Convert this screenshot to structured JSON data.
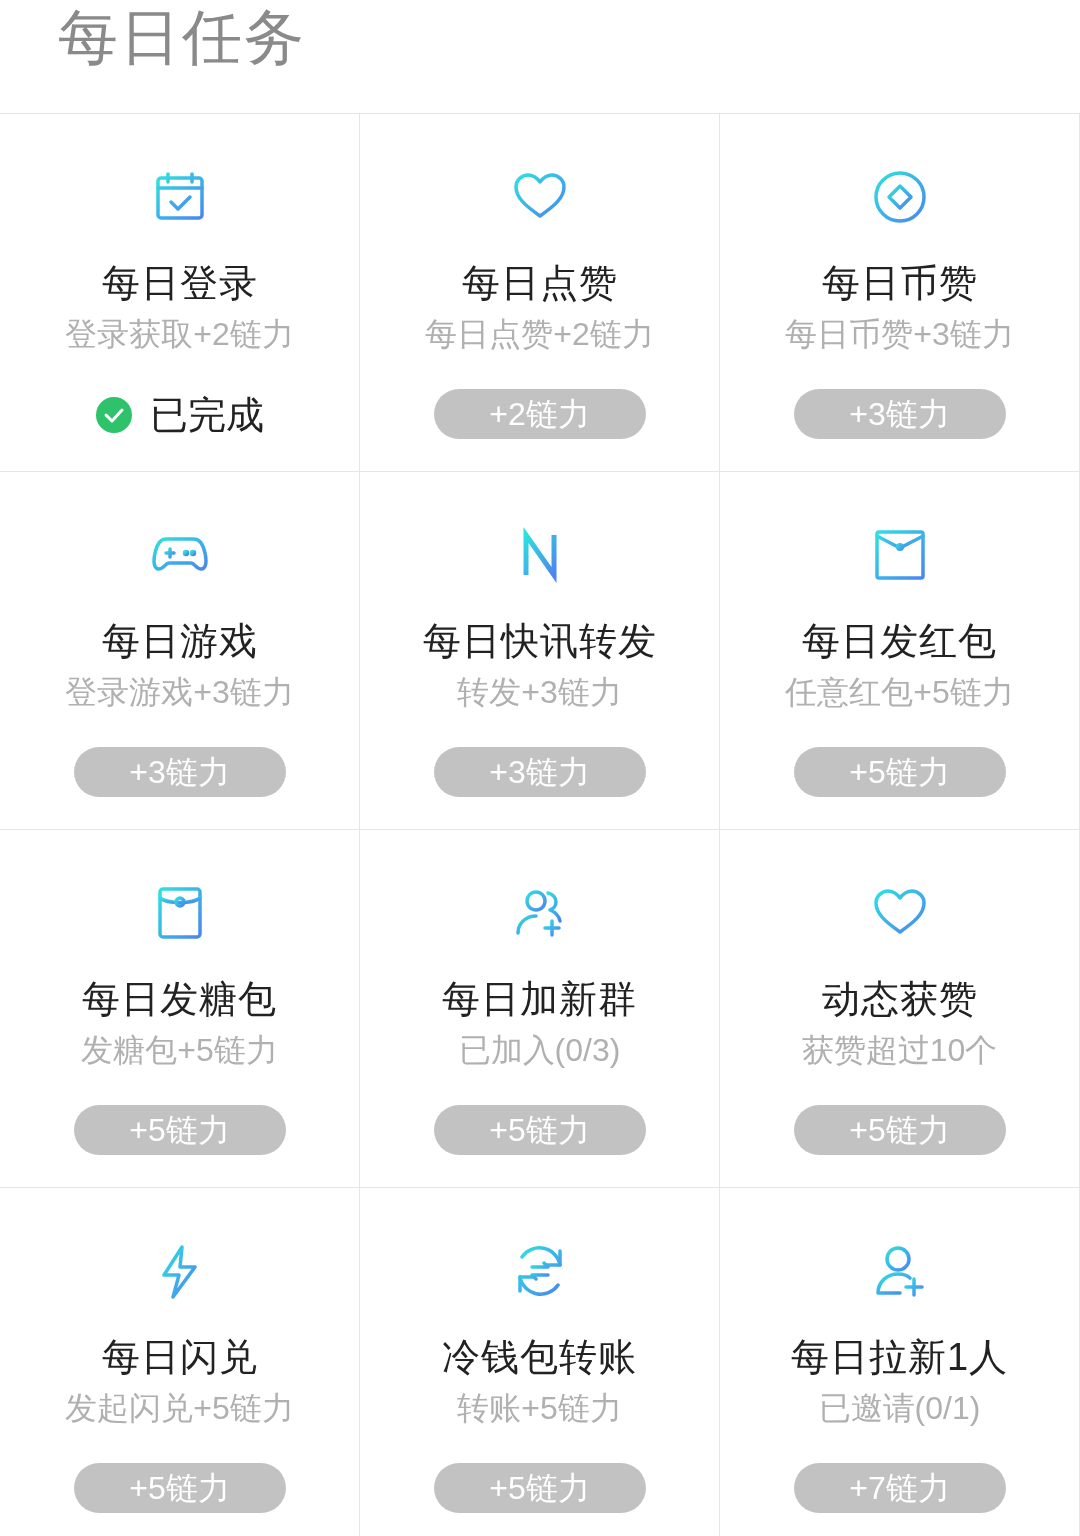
{
  "header": {
    "title": "每日任务"
  },
  "tasks": [
    {
      "title": "每日登录",
      "desc": "登录获取+2链力",
      "kind": "completed",
      "status": "已完成"
    },
    {
      "title": "每日点赞",
      "desc": "每日点赞+2链力",
      "kind": "reward",
      "reward": "+2链力"
    },
    {
      "title": "每日币赞",
      "desc": "每日币赞+3链力",
      "kind": "reward",
      "reward": "+3链力"
    },
    {
      "title": "每日游戏",
      "desc": "登录游戏+3链力",
      "kind": "reward",
      "reward": "+3链力"
    },
    {
      "title": "每日快讯转发",
      "desc": "转发+3链力",
      "kind": "reward",
      "reward": "+3链力"
    },
    {
      "title": "每日发红包",
      "desc": "任意红包+5链力",
      "kind": "reward",
      "reward": "+5链力"
    },
    {
      "title": "每日发糖包",
      "desc": "发糖包+5链力",
      "kind": "reward",
      "reward": "+5链力"
    },
    {
      "title": "每日加新群",
      "desc": "已加入(0/3)",
      "kind": "reward",
      "reward": "+5链力"
    },
    {
      "title": "动态获赞",
      "desc": "获赞超过10个",
      "kind": "reward",
      "reward": "+5链力"
    },
    {
      "title": "每日闪兑",
      "desc": "发起闪兑+5链力",
      "kind": "reward",
      "reward": "+5链力"
    },
    {
      "title": "冷钱包转账",
      "desc": "转账+5链力",
      "kind": "reward",
      "reward": "+5链力"
    },
    {
      "title": "每日拉新1人",
      "desc": "已邀请(0/1)",
      "kind": "reward",
      "reward": "+7链力"
    }
  ]
}
